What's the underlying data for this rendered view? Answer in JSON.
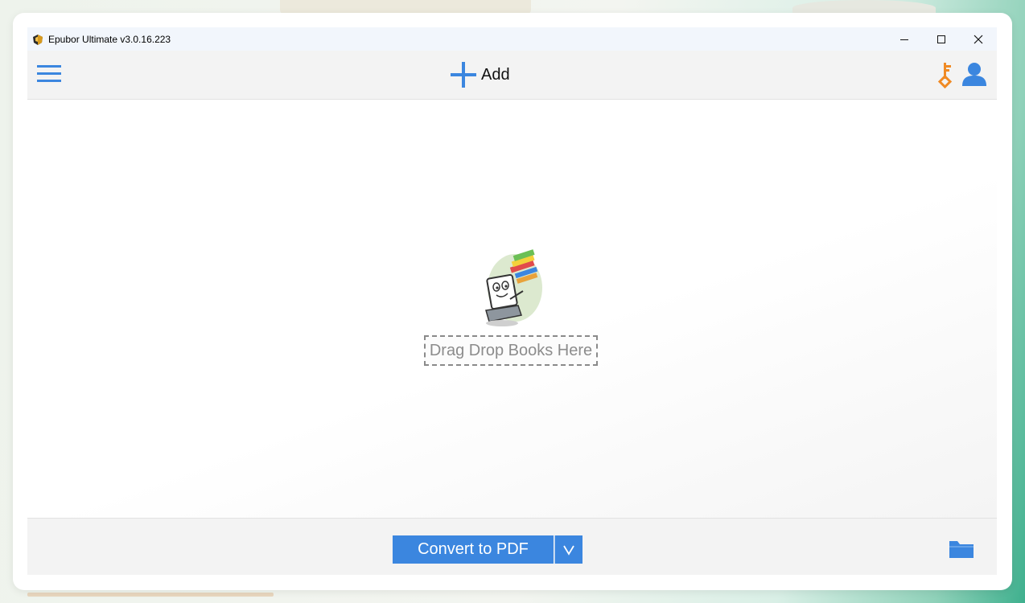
{
  "window": {
    "title": "Epubor Ultimate v3.0.16.223",
    "controls": [
      "minimize-icon",
      "maximize-icon",
      "close-icon"
    ]
  },
  "toolbar": {
    "menu_icon": "hamburger-menu-icon",
    "add_label": "Add",
    "add_icon": "plus-icon",
    "key_icon": "key-icon",
    "user_icon": "user-icon"
  },
  "content": {
    "illustration": "laptop-with-books-illustration",
    "drop_text": "Drag Drop Books Here"
  },
  "bottombar": {
    "convert_label": "Convert to PDF",
    "dropdown_glyph": "V",
    "folder_icon": "folder-icon"
  },
  "colors": {
    "accent": "#3b86df",
    "key": "#f08a24",
    "toolbar_bg": "#f3f3f3"
  }
}
